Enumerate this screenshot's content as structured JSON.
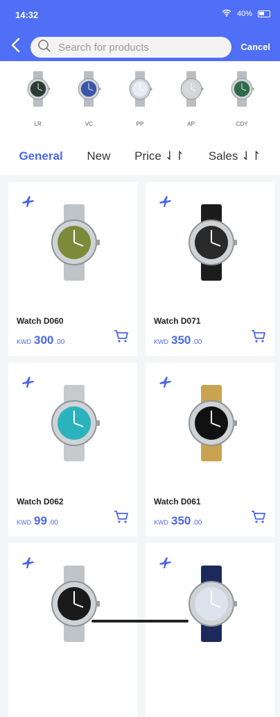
{
  "status": {
    "time": "14:32",
    "battery": "40%"
  },
  "header": {
    "search_placeholder": "Search for products",
    "cancel_label": "Cancel"
  },
  "brands": [
    {
      "label": "LR",
      "dial": "#2e3b33"
    },
    {
      "label": "VC",
      "dial": "#3b56a8"
    },
    {
      "label": "PP",
      "dial": "#e8ecf4"
    },
    {
      "label": "AP",
      "dial": "#d8d8d8"
    },
    {
      "label": "CDY",
      "dial": "#2f6a4a"
    }
  ],
  "tabs": [
    {
      "label": "General",
      "active": true
    },
    {
      "label": "New",
      "active": false
    },
    {
      "label": "Price ⇃↾",
      "active": false
    },
    {
      "label": "Sales ⇃↾",
      "active": false
    }
  ],
  "products": [
    {
      "name": "Watch D060",
      "currency": "KWD",
      "price_int": "300",
      "price_dec": ".00",
      "dial": "#7c8a3a",
      "band": "#bfc4c8"
    },
    {
      "name": "Watch D071",
      "currency": "KWD",
      "price_int": "350",
      "price_dec": ".00",
      "dial": "#2a2a2a",
      "band": "#1c1c1c"
    },
    {
      "name": "Watch D062",
      "currency": "KWD",
      "price_int": "99",
      "price_dec": ".00",
      "dial": "#2bb3bd",
      "band": "#c6cacd"
    },
    {
      "name": "Watch D061",
      "currency": "KWD",
      "price_int": "350",
      "price_dec": ".00",
      "dial": "#111111",
      "band": "#c9a34f"
    },
    {
      "name": "",
      "currency": "",
      "price_int": "",
      "price_dec": "",
      "dial": "#1a1a1a",
      "band": "#bfc4c8"
    },
    {
      "name": "",
      "currency": "",
      "price_int": "",
      "price_dec": "",
      "dial": "#dde3ee",
      "band": "#1b2a5a"
    }
  ],
  "colors": {
    "accent": "#4a66e8",
    "header": "#4f6ff7"
  }
}
